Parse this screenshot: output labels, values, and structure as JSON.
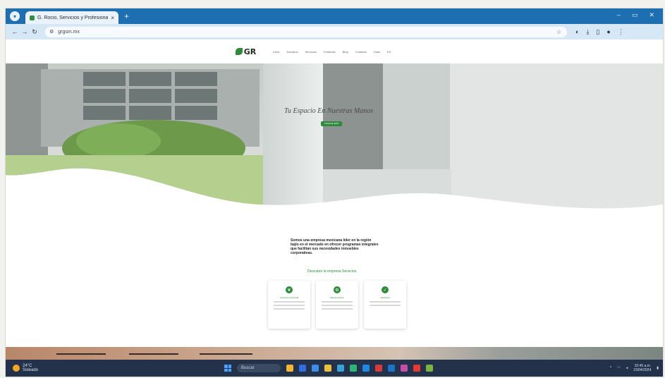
{
  "browser": {
    "tab_title": "G. Rocio, Servicios y Profesionales",
    "tab_close": "×",
    "new_tab": "+",
    "url": "grgsm.mx",
    "window_controls": [
      "–",
      "▭",
      "✕"
    ]
  },
  "site": {
    "logo_text": "GR",
    "menu": [
      "Inicio",
      "Nosotros",
      "Servicios",
      "Portafolio",
      "Blog",
      "Contacto",
      "Citas",
      "ES"
    ],
    "hero_title": "Tu Espacio En Nuestras Manos",
    "hero_button": "CONOCE MÁS",
    "intro": "Somos una empresa mexicana líder en la región bajío en el mercado en ofrecer programas integrales que facilitan sus necesidades inmuebles corporativas.",
    "intro_link": "Descubre la empresa Servicios",
    "cards": [
      {
        "title": "Limpieza Comercial",
        "icon": "leaf-icon"
      },
      {
        "title": "Mantenimiento",
        "icon": "gear-icon"
      },
      {
        "title": "Jardinería",
        "icon": "check-icon"
      }
    ]
  },
  "taskbar": {
    "weather_temp": "24°C",
    "weather_desc": "Soleado",
    "search_placeholder": "Buscar",
    "time": "10:45 a.m.",
    "date": "15/04/2024"
  },
  "colors": {
    "browser_accent": "#1d6fb1",
    "brand_green": "#2e8b3a",
    "taskbar": "#23324a"
  }
}
